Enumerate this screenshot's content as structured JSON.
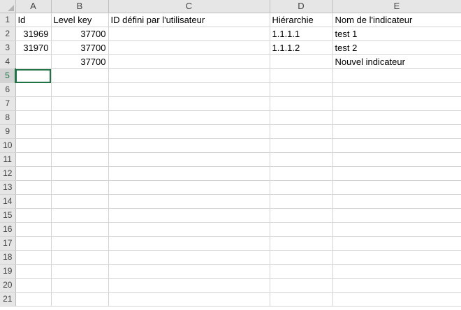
{
  "columns": [
    "A",
    "B",
    "C",
    "D",
    "E"
  ],
  "rows": [
    {
      "num": "1",
      "cells": [
        "Id",
        "Level key",
        "ID défini par l'utilisateur",
        "Hiérarchie",
        "Nom de l'indicateur"
      ]
    },
    {
      "num": "2",
      "cells": [
        "31969",
        "37700",
        "",
        "1.1.1.1",
        "test 1"
      ]
    },
    {
      "num": "3",
      "cells": [
        "31970",
        "37700",
        "",
        "1.1.1.2",
        "test 2"
      ]
    },
    {
      "num": "4",
      "cells": [
        "",
        "37700",
        "",
        "",
        "Nouvel indicateur"
      ]
    },
    {
      "num": "5",
      "cells": [
        "",
        "",
        "",
        "",
        ""
      ]
    },
    {
      "num": "6",
      "cells": [
        "",
        "",
        "",
        "",
        ""
      ]
    },
    {
      "num": "7",
      "cells": [
        "",
        "",
        "",
        "",
        ""
      ]
    },
    {
      "num": "8",
      "cells": [
        "",
        "",
        "",
        "",
        ""
      ]
    },
    {
      "num": "9",
      "cells": [
        "",
        "",
        "",
        "",
        ""
      ]
    },
    {
      "num": "10",
      "cells": [
        "",
        "",
        "",
        "",
        ""
      ]
    },
    {
      "num": "11",
      "cells": [
        "",
        "",
        "",
        "",
        ""
      ]
    },
    {
      "num": "12",
      "cells": [
        "",
        "",
        "",
        "",
        ""
      ]
    },
    {
      "num": "13",
      "cells": [
        "",
        "",
        "",
        "",
        ""
      ]
    },
    {
      "num": "14",
      "cells": [
        "",
        "",
        "",
        "",
        ""
      ]
    },
    {
      "num": "15",
      "cells": [
        "",
        "",
        "",
        "",
        ""
      ]
    },
    {
      "num": "16",
      "cells": [
        "",
        "",
        "",
        "",
        ""
      ]
    },
    {
      "num": "17",
      "cells": [
        "",
        "",
        "",
        "",
        ""
      ]
    },
    {
      "num": "18",
      "cells": [
        "",
        "",
        "",
        "",
        ""
      ]
    },
    {
      "num": "19",
      "cells": [
        "",
        "",
        "",
        "",
        ""
      ]
    },
    {
      "num": "20",
      "cells": [
        "",
        "",
        "",
        "",
        ""
      ]
    },
    {
      "num": "21",
      "cells": [
        "",
        "",
        "",
        "",
        ""
      ]
    }
  ],
  "numeric_columns": [
    "A",
    "B"
  ],
  "active_cell": "A5",
  "colors": {
    "header_bg": "#e6e6e6",
    "gridline": "#d4d4d4",
    "selection": "#217346"
  }
}
